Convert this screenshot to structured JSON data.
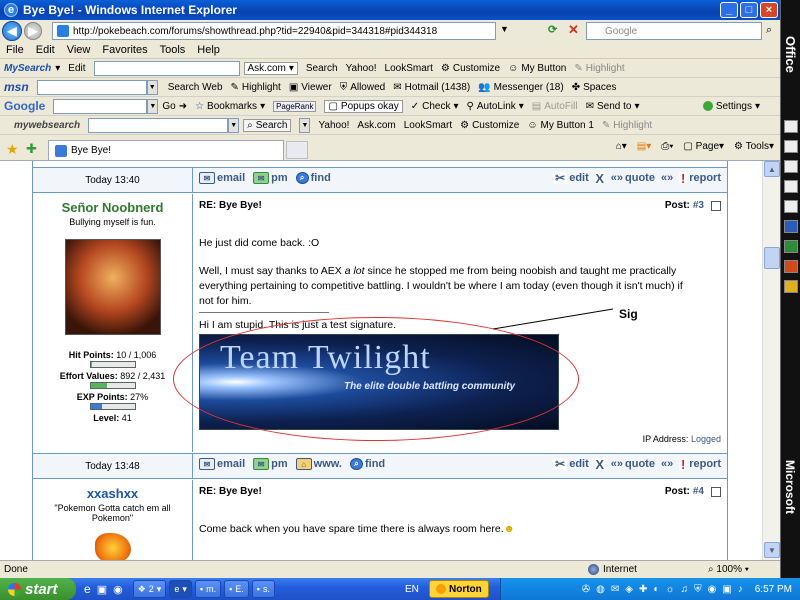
{
  "window": {
    "title": "Bye Bye! - Windows Internet Explorer"
  },
  "address": {
    "url": "http://pokebeach.com/forums/showthread.php?tid=22940&pid=344318#pid344318",
    "search_placeholder": "Google"
  },
  "menu": [
    "File",
    "Edit",
    "View",
    "Favorites",
    "Tools",
    "Help"
  ],
  "toolbar1": {
    "brand": "MySearch",
    "edit": "Edit",
    "provider": "Ask.com",
    "items": [
      "Search",
      "Yahoo!",
      "LookSmart",
      "Customize",
      "My Button",
      "Highlight"
    ]
  },
  "toolbar2": {
    "brand": "msn",
    "items": [
      "Search Web",
      "Highlight",
      "Viewer",
      "Allowed",
      "Hotmail (1438)",
      "Messenger (18)",
      "Spaces"
    ]
  },
  "toolbar3": {
    "brand": "Google",
    "go": "Go",
    "items": [
      "Bookmarks",
      "PageRank",
      "Popups okay",
      "Check",
      "AutoLink",
      "AutoFill",
      "Send to"
    ],
    "settings": "Settings"
  },
  "toolbar4": {
    "brand": "mywebsearch",
    "items": [
      "Search",
      "Yahoo!",
      "Ask.com",
      "LookSmart",
      "Customize",
      "My Button 1",
      "Highlight"
    ]
  },
  "tab": {
    "label": "Bye Bye!"
  },
  "commands": {
    "page": "Page",
    "tools": "Tools"
  },
  "forum": {
    "row1": {
      "date": "Today 13:40",
      "actions": [
        "email",
        "pm",
        "find"
      ],
      "right": [
        "edit",
        "quote",
        "report"
      ]
    },
    "post3": {
      "username": "Señor Noobnerd",
      "usertitle": "Bullying myself is fun.",
      "hp_label": "Hit Points:",
      "hp_value": "10 / 1,006",
      "hp_fraction": 0.01,
      "ev_label": "Effort Values:",
      "ev_value": "892 / 2,431",
      "ev_fraction": 0.37,
      "exp_label": "EXP Points:",
      "exp_value": "27%",
      "exp_fraction": 0.27,
      "level_label": "Level:",
      "level_value": "41",
      "subject": "RE: Bye Bye!",
      "post_label": "Post:",
      "post_number": "#3",
      "line1": "He just did come back. :O",
      "line2a": "Well, I must say thanks to AEX ",
      "line2_em": "a lot",
      "line2b": " since he stopped me from being noobish and taught me practically everything pertaining to competitive battling. I wouldn't be where I am today (even though it isn't much) if not for him.",
      "signature": "Hi I am stupid. This is just a test signature.",
      "banner_title": "Team Twilight",
      "banner_subtitle": "The elite double battling community",
      "annotation": "Sig",
      "ip_label": "IP Address:",
      "ip_value": "Logged"
    },
    "row2": {
      "date": "Today 13:48",
      "actions": [
        "email",
        "pm",
        "www.",
        "find"
      ],
      "right": [
        "edit",
        "quote",
        "report"
      ]
    },
    "post4": {
      "username": "xxashxx",
      "usertitle": "\"Pokemon Gotta catch em all Pokemon\"",
      "subject": "RE: Bye Bye!",
      "post_label": "Post:",
      "post_number": "#4",
      "line1": "Come back when you have spare time there is always room here."
    }
  },
  "status": {
    "left": "Done",
    "zone": "Internet",
    "zoom": "100%"
  },
  "taskbar": {
    "start": "start",
    "tasks": [
      "2",
      "m.",
      "E.",
      "s."
    ],
    "lang": "EN",
    "norton": "Norton",
    "clock": "6:57 PM"
  },
  "officebar": {
    "top": "Office",
    "bottom": "Microsoft"
  },
  "colors": {
    "title_blue": "#0a5fd8",
    "username_green": "#2f7a2f",
    "link_blue": "#3d5a84",
    "report_red": "#dd2222",
    "oval_red": "#dd3333"
  }
}
